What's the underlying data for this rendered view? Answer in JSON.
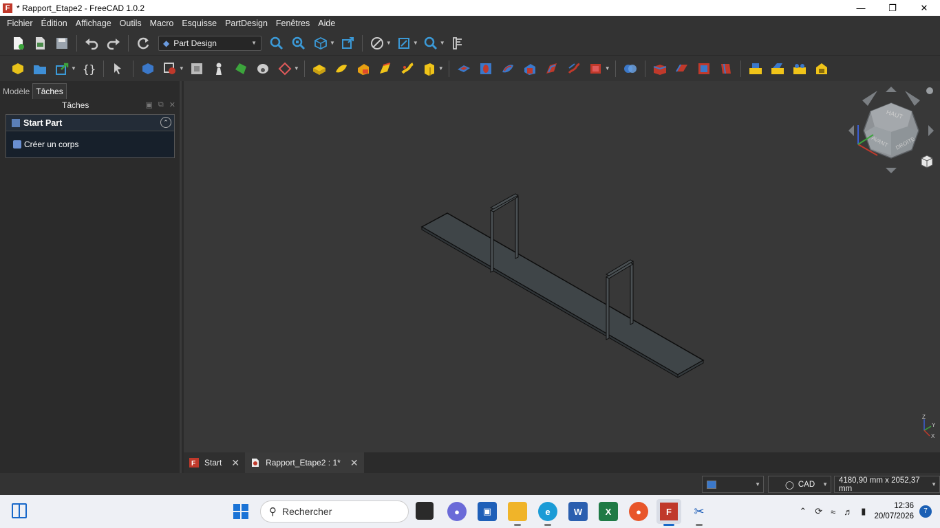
{
  "window": {
    "title": "* Rapport_Etape2 - FreeCAD 1.0.2",
    "app_icon": "freecad-icon",
    "controls": [
      "minimize",
      "restore",
      "close"
    ]
  },
  "menu": [
    "Fichier",
    "Édition",
    "Affichage",
    "Outils",
    "Macro",
    "Esquisse",
    "PartDesign",
    "Fenêtres",
    "Aide"
  ],
  "toolbar": {
    "workbench": "Part Design"
  },
  "panel": {
    "tabs": [
      "Modèle",
      "Tâches"
    ],
    "active_tab": "Tâches",
    "header_title": "Tâches",
    "task_title": "Start Part",
    "task_item": "Créer un corps"
  },
  "navcube": {
    "top": "HAUT",
    "front": "AVANT",
    "right": "DROITE",
    "axes": [
      "Z",
      "Y",
      "X"
    ]
  },
  "doc_tabs": [
    {
      "label": "Start",
      "active": false
    },
    {
      "label": "Rapport_Etape2 : 1*",
      "active": true
    }
  ],
  "status": {
    "nav_style": "CAD",
    "dimensions": "4180,90 mm x 2052,37 mm"
  },
  "taskbar": {
    "search_placeholder": "Rechercher",
    "time": "12:36",
    "date": "20/07/2026",
    "notifications": "7"
  },
  "colors": {
    "viewport_bg": "#383838",
    "model_face": "#3f4548",
    "model_edge": "#0d0d0d",
    "accent": "#c0392b"
  }
}
